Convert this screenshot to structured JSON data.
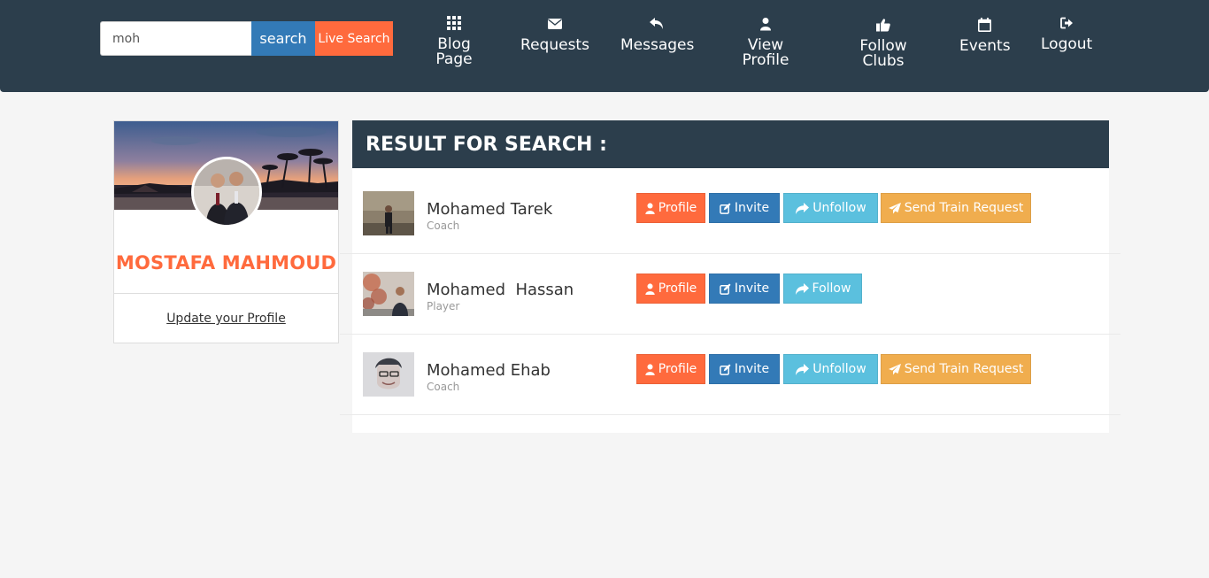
{
  "search": {
    "value": "moh",
    "search_label": "search",
    "live_label": "Live Search"
  },
  "nav": [
    {
      "label": "Blog Page",
      "icon": "grid-icon"
    },
    {
      "label": "Requests",
      "icon": "envelope-icon"
    },
    {
      "label": "Messages",
      "icon": "reply-icon"
    },
    {
      "label": "View Profile",
      "icon": "user-icon"
    },
    {
      "label": "Follow Clubs",
      "icon": "thumbs-up-icon"
    },
    {
      "label": "Events",
      "icon": "calendar-icon"
    },
    {
      "label": "Logout",
      "icon": "logout-icon"
    }
  ],
  "profile": {
    "name": "MOSTAFA MAHMOUD",
    "update_link": "Update your Profile"
  },
  "results": {
    "title": "RESULT FOR SEARCH :",
    "rows": [
      {
        "name": "Mohamed Tarek",
        "role": "Coach",
        "profile_label": "Profile",
        "invite_label": "Invite",
        "follow_label": "Unfollow",
        "train_label": "Send Train Request"
      },
      {
        "name": "Mohamed  Hassan",
        "role": "Player",
        "profile_label": "Profile",
        "invite_label": "Invite",
        "follow_label": "Follow"
      },
      {
        "name": "Mohamed Ehab",
        "role": "Coach",
        "profile_label": "Profile",
        "invite_label": "Invite",
        "follow_label": "Unfollow",
        "train_label": "Send Train Request"
      }
    ]
  },
  "colors": {
    "header": "#2c3e4c",
    "accent_orange": "#ff6a3d",
    "primary_blue": "#337ab7",
    "info": "#5bc0de",
    "warning": "#f0ad4e"
  }
}
